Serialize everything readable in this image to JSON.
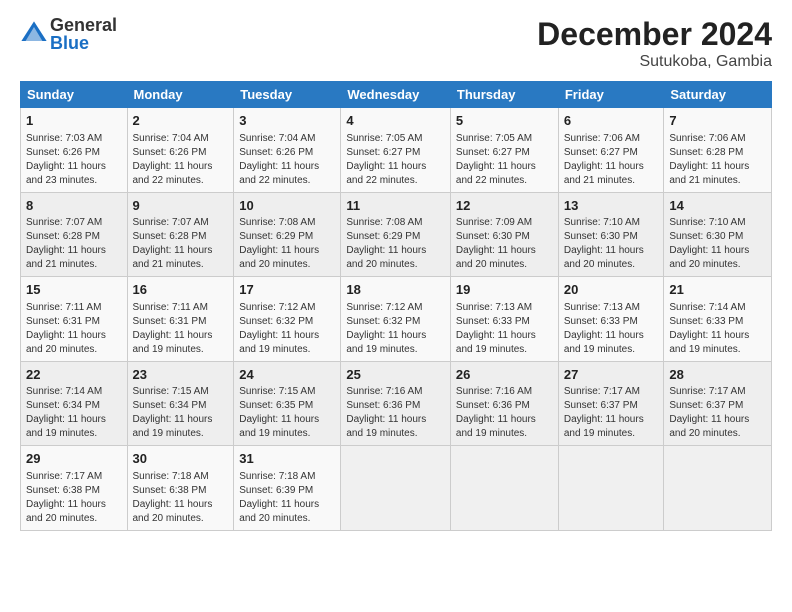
{
  "logo": {
    "general": "General",
    "blue": "Blue"
  },
  "title": "December 2024",
  "subtitle": "Sutukoba, Gambia",
  "days_of_week": [
    "Sunday",
    "Monday",
    "Tuesday",
    "Wednesday",
    "Thursday",
    "Friday",
    "Saturday"
  ],
  "weeks": [
    [
      {
        "day": "1",
        "info": "Sunrise: 7:03 AM\nSunset: 6:26 PM\nDaylight: 11 hours\nand 23 minutes."
      },
      {
        "day": "2",
        "info": "Sunrise: 7:04 AM\nSunset: 6:26 PM\nDaylight: 11 hours\nand 22 minutes."
      },
      {
        "day": "3",
        "info": "Sunrise: 7:04 AM\nSunset: 6:26 PM\nDaylight: 11 hours\nand 22 minutes."
      },
      {
        "day": "4",
        "info": "Sunrise: 7:05 AM\nSunset: 6:27 PM\nDaylight: 11 hours\nand 22 minutes."
      },
      {
        "day": "5",
        "info": "Sunrise: 7:05 AM\nSunset: 6:27 PM\nDaylight: 11 hours\nand 22 minutes."
      },
      {
        "day": "6",
        "info": "Sunrise: 7:06 AM\nSunset: 6:27 PM\nDaylight: 11 hours\nand 21 minutes."
      },
      {
        "day": "7",
        "info": "Sunrise: 7:06 AM\nSunset: 6:28 PM\nDaylight: 11 hours\nand 21 minutes."
      }
    ],
    [
      {
        "day": "8",
        "info": "Sunrise: 7:07 AM\nSunset: 6:28 PM\nDaylight: 11 hours\nand 21 minutes."
      },
      {
        "day": "9",
        "info": "Sunrise: 7:07 AM\nSunset: 6:28 PM\nDaylight: 11 hours\nand 21 minutes."
      },
      {
        "day": "10",
        "info": "Sunrise: 7:08 AM\nSunset: 6:29 PM\nDaylight: 11 hours\nand 20 minutes."
      },
      {
        "day": "11",
        "info": "Sunrise: 7:08 AM\nSunset: 6:29 PM\nDaylight: 11 hours\nand 20 minutes."
      },
      {
        "day": "12",
        "info": "Sunrise: 7:09 AM\nSunset: 6:30 PM\nDaylight: 11 hours\nand 20 minutes."
      },
      {
        "day": "13",
        "info": "Sunrise: 7:10 AM\nSunset: 6:30 PM\nDaylight: 11 hours\nand 20 minutes."
      },
      {
        "day": "14",
        "info": "Sunrise: 7:10 AM\nSunset: 6:30 PM\nDaylight: 11 hours\nand 20 minutes."
      }
    ],
    [
      {
        "day": "15",
        "info": "Sunrise: 7:11 AM\nSunset: 6:31 PM\nDaylight: 11 hours\nand 20 minutes."
      },
      {
        "day": "16",
        "info": "Sunrise: 7:11 AM\nSunset: 6:31 PM\nDaylight: 11 hours\nand 19 minutes."
      },
      {
        "day": "17",
        "info": "Sunrise: 7:12 AM\nSunset: 6:32 PM\nDaylight: 11 hours\nand 19 minutes."
      },
      {
        "day": "18",
        "info": "Sunrise: 7:12 AM\nSunset: 6:32 PM\nDaylight: 11 hours\nand 19 minutes."
      },
      {
        "day": "19",
        "info": "Sunrise: 7:13 AM\nSunset: 6:33 PM\nDaylight: 11 hours\nand 19 minutes."
      },
      {
        "day": "20",
        "info": "Sunrise: 7:13 AM\nSunset: 6:33 PM\nDaylight: 11 hours\nand 19 minutes."
      },
      {
        "day": "21",
        "info": "Sunrise: 7:14 AM\nSunset: 6:33 PM\nDaylight: 11 hours\nand 19 minutes."
      }
    ],
    [
      {
        "day": "22",
        "info": "Sunrise: 7:14 AM\nSunset: 6:34 PM\nDaylight: 11 hours\nand 19 minutes."
      },
      {
        "day": "23",
        "info": "Sunrise: 7:15 AM\nSunset: 6:34 PM\nDaylight: 11 hours\nand 19 minutes."
      },
      {
        "day": "24",
        "info": "Sunrise: 7:15 AM\nSunset: 6:35 PM\nDaylight: 11 hours\nand 19 minutes."
      },
      {
        "day": "25",
        "info": "Sunrise: 7:16 AM\nSunset: 6:36 PM\nDaylight: 11 hours\nand 19 minutes."
      },
      {
        "day": "26",
        "info": "Sunrise: 7:16 AM\nSunset: 6:36 PM\nDaylight: 11 hours\nand 19 minutes."
      },
      {
        "day": "27",
        "info": "Sunrise: 7:17 AM\nSunset: 6:37 PM\nDaylight: 11 hours\nand 19 minutes."
      },
      {
        "day": "28",
        "info": "Sunrise: 7:17 AM\nSunset: 6:37 PM\nDaylight: 11 hours\nand 20 minutes."
      }
    ],
    [
      {
        "day": "29",
        "info": "Sunrise: 7:17 AM\nSunset: 6:38 PM\nDaylight: 11 hours\nand 20 minutes."
      },
      {
        "day": "30",
        "info": "Sunrise: 7:18 AM\nSunset: 6:38 PM\nDaylight: 11 hours\nand 20 minutes."
      },
      {
        "day": "31",
        "info": "Sunrise: 7:18 AM\nSunset: 6:39 PM\nDaylight: 11 hours\nand 20 minutes."
      },
      {
        "day": "",
        "info": ""
      },
      {
        "day": "",
        "info": ""
      },
      {
        "day": "",
        "info": ""
      },
      {
        "day": "",
        "info": ""
      }
    ]
  ]
}
